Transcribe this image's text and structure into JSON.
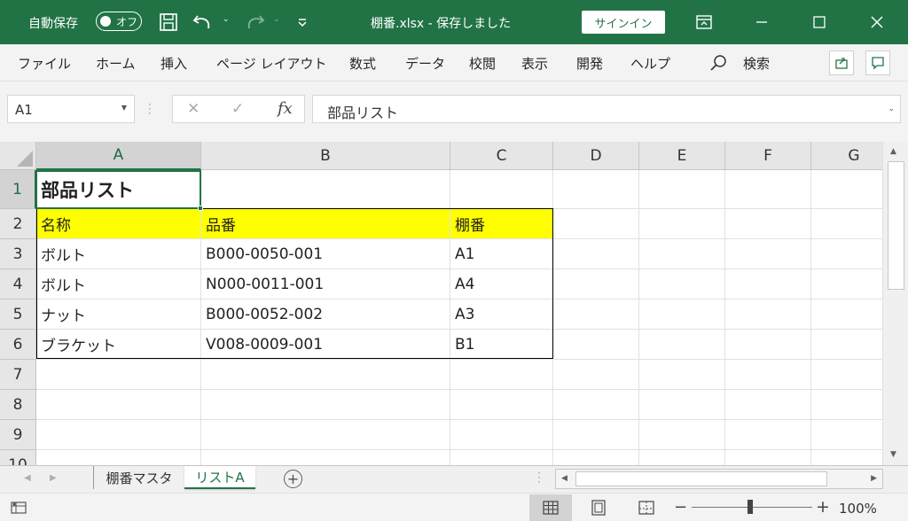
{
  "titlebar": {
    "autosave_label": "自動保存",
    "autosave_state": "オフ",
    "doc_title": "棚番.xlsx  -  保存しました",
    "signin_label": "サインイン",
    "accent": "#217346"
  },
  "ribbon": {
    "tabs": [
      "ファイル",
      "ホーム",
      "挿入",
      "ページ レイアウト",
      "数式",
      "データ",
      "校閲",
      "表示",
      "開発",
      "ヘルプ"
    ],
    "search_label": "検索"
  },
  "formula_bar": {
    "namebox": "A1",
    "content": "部品リスト"
  },
  "sheet": {
    "columns": [
      "A",
      "B",
      "C",
      "D",
      "E",
      "F",
      "G"
    ],
    "rows": [
      "1",
      "2",
      "3",
      "4",
      "5",
      "6",
      "7",
      "8",
      "9",
      "10"
    ],
    "title": "部品リスト",
    "headers": [
      "名称",
      "品番",
      "棚番"
    ],
    "data": [
      [
        "ボルト",
        "B000-0050-001",
        "A1"
      ],
      [
        "ボルト",
        "N000-0011-001",
        "A4"
      ],
      [
        "ナット",
        "B000-0052-002",
        "A3"
      ],
      [
        "ブラケット",
        "V008-0009-001",
        "B1"
      ]
    ],
    "header_fill": "#ffff00"
  },
  "sheet_tabs": [
    "棚番マスタ",
    "リストA"
  ],
  "active_sheet": "リストA",
  "statusbar": {
    "zoom": "100%"
  }
}
